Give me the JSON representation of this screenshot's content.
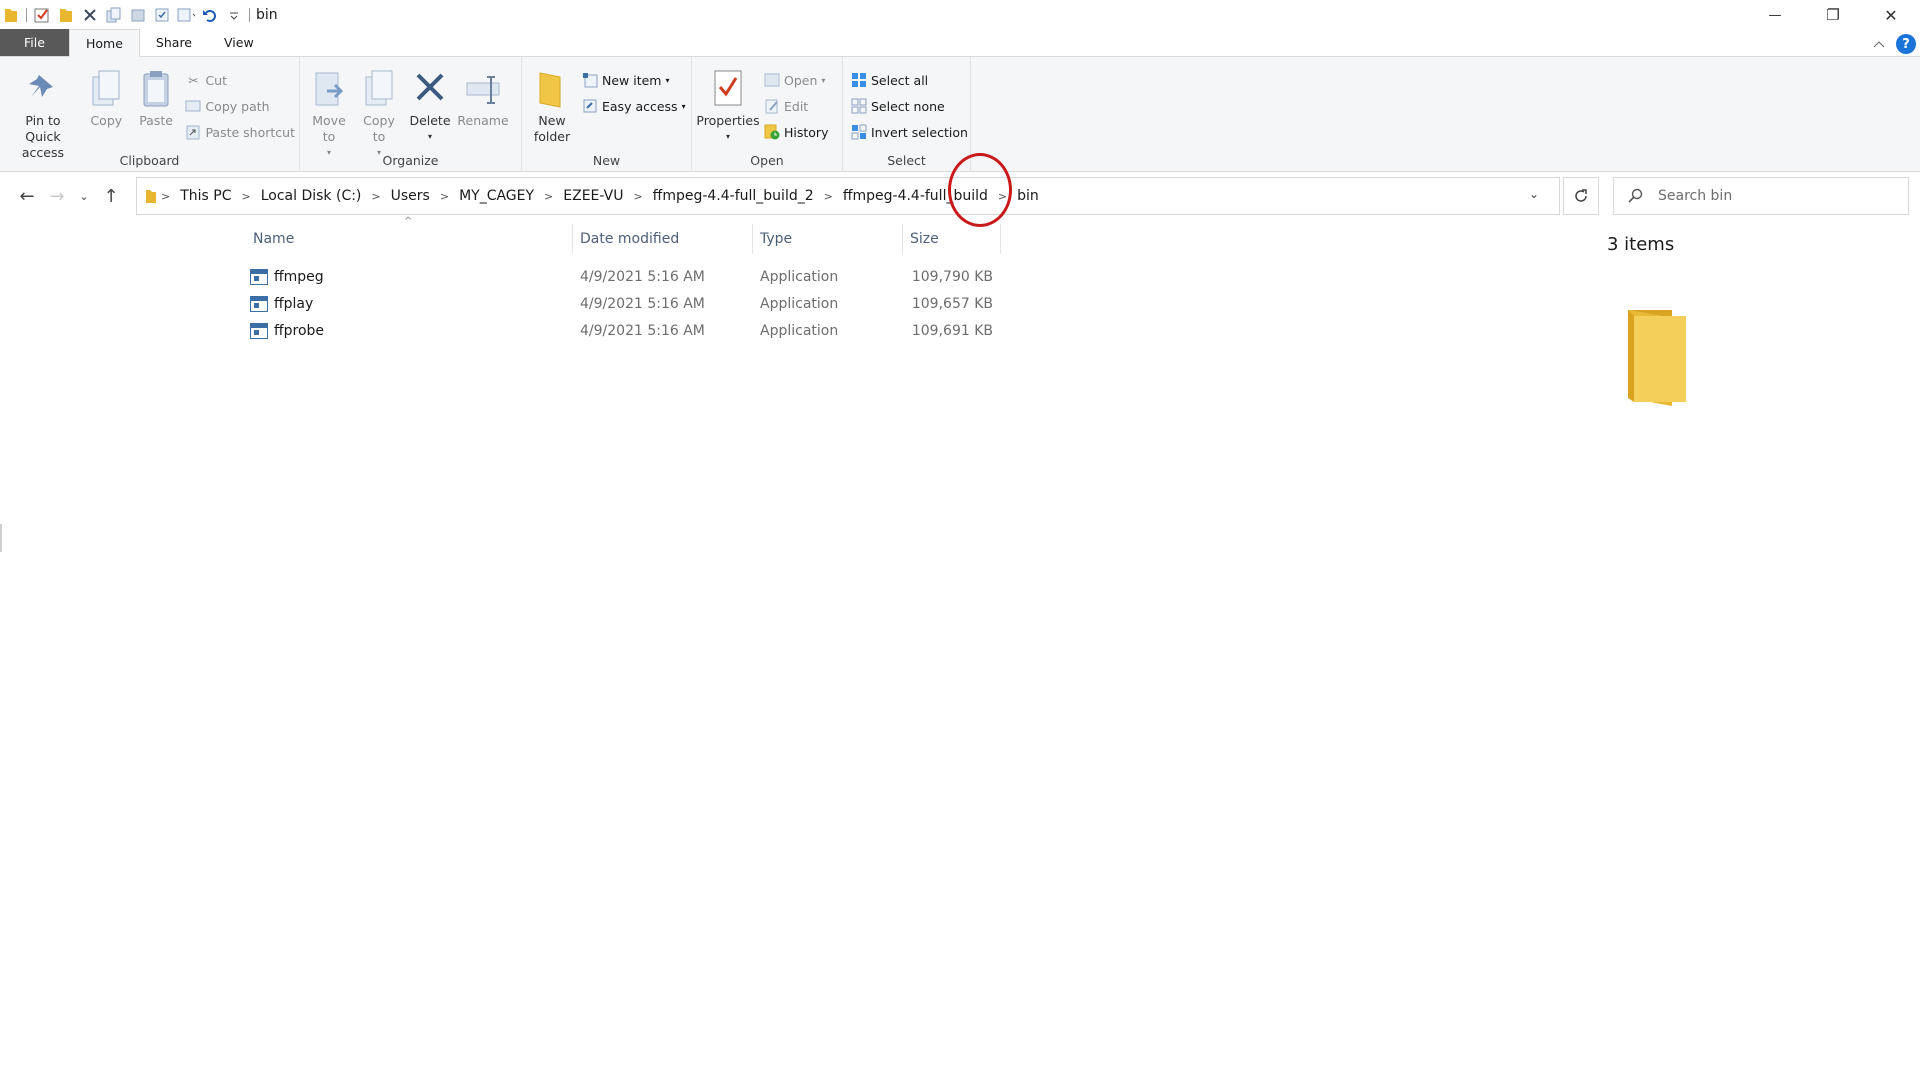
{
  "window": {
    "title": "bin",
    "controls": {
      "minimize": "—",
      "restore": "❐",
      "close": "✕"
    }
  },
  "tabs": [
    {
      "label": "File"
    },
    {
      "label": "Home"
    },
    {
      "label": "Share"
    },
    {
      "label": "View"
    }
  ],
  "help": "?",
  "ribbon": {
    "clipboard": {
      "label": "Clipboard",
      "pin": "Pin to Quick access",
      "copy": "Copy",
      "paste": "Paste",
      "cut": "Cut",
      "copy_path": "Copy path",
      "paste_shortcut": "Paste shortcut"
    },
    "organize": {
      "label": "Organize",
      "move_to": "Move to",
      "copy_to": "Copy to",
      "delete": "Delete",
      "rename": "Rename"
    },
    "new": {
      "label": "New",
      "new_folder": "New folder",
      "new_item": "New item",
      "easy_access": "Easy access"
    },
    "open": {
      "label": "Open",
      "properties": "Properties",
      "open": "Open",
      "edit": "Edit",
      "history": "History"
    },
    "select": {
      "label": "Select",
      "select_all": "Select all",
      "select_none": "Select none",
      "invert": "Invert selection"
    }
  },
  "breadcrumb": [
    "This PC",
    "Local Disk (C:)",
    "Users",
    "MY_CAGEY",
    "EZEE-VU",
    "ffmpeg-4.4-full_build_2",
    "ffmpeg-4.4-full_build",
    "bin"
  ],
  "search": {
    "placeholder": "Search bin"
  },
  "columns": {
    "name": "Name",
    "date": "Date modified",
    "type": "Type",
    "size": "Size"
  },
  "files": [
    {
      "name": "ffmpeg",
      "date": "4/9/2021 5:16 AM",
      "type": "Application",
      "size": "109,790 KB"
    },
    {
      "name": "ffplay",
      "date": "4/9/2021 5:16 AM",
      "type": "Application",
      "size": "109,657 KB"
    },
    {
      "name": "ffprobe",
      "date": "4/9/2021 5:16 AM",
      "type": "Application",
      "size": "109,691 KB"
    }
  ],
  "details": {
    "count": "3 items"
  }
}
